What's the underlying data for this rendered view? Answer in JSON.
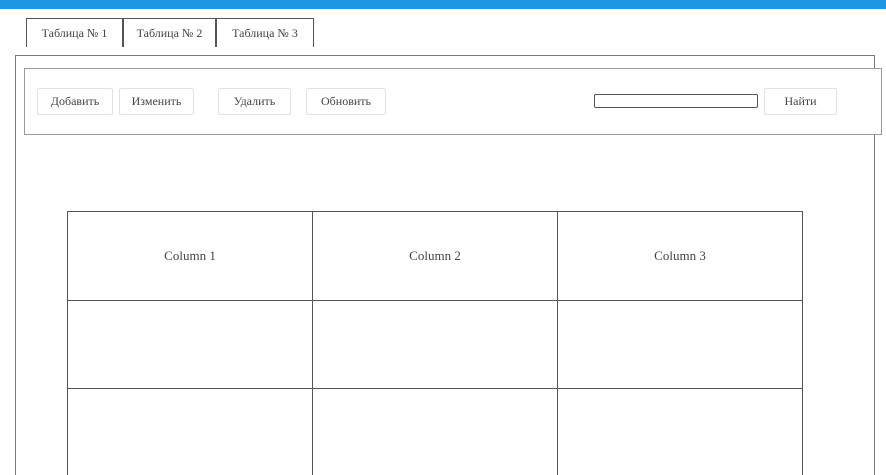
{
  "tabs": [
    {
      "label": "Таблица № 1"
    },
    {
      "label": "Таблица № 2"
    },
    {
      "label": "Таблица № 3"
    }
  ],
  "toolbar": {
    "add_label": "Добавить",
    "edit_label": "Изменить",
    "delete_label": "Удалить",
    "refresh_label": "Обновить",
    "search_value": "",
    "find_label": "Найти"
  },
  "table": {
    "columns": [
      "Column 1",
      "Column 2",
      "Column 3"
    ],
    "rows": [
      [
        "",
        "",
        ""
      ],
      [
        "",
        "",
        ""
      ]
    ]
  },
  "colors": {
    "top_bar": "#1e96e2",
    "border": "#555555"
  }
}
